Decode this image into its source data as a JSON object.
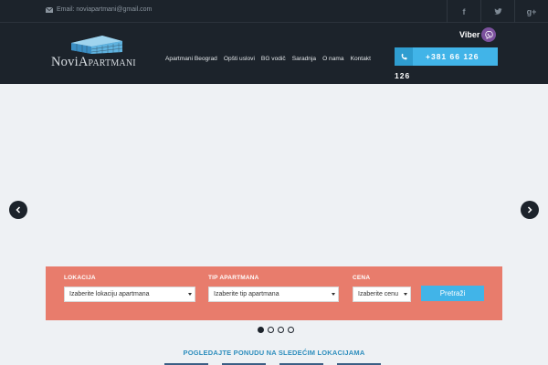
{
  "topbar": {
    "email": "Email: noviapartmani@gmail.com",
    "social": [
      "facebook-icon",
      "twitter-icon",
      "google-plus-icon"
    ]
  },
  "logo": {
    "part1": "Novi",
    "part2": "Apartmani"
  },
  "nav": [
    "Apartmani Beograd",
    "Opšti uslovi",
    "BG vodič",
    "Saradnja",
    "O nama",
    "Kontakt"
  ],
  "viber": {
    "label": "Viber"
  },
  "phone": {
    "line1": "+381 66 126",
    "line2": "126"
  },
  "search": {
    "location_label": "LOKACIJA",
    "location_value": "Izaberite lokaciju apartmana",
    "type_label": "TIP APARTMANA",
    "type_value": "Izaberite tip apartmana",
    "price_label": "CENA",
    "price_value": "Izaberite cenu",
    "submit": "Pretraži"
  },
  "slider": {
    "dots": 4,
    "active": 1
  },
  "caption": "POGLEDAJTE PONUDU NA SLEDEĆIM LOKACIJAMA",
  "colors": {
    "dark": "#1c232b",
    "accent": "#41b4e8",
    "search_bg": "#e87c6c",
    "caption": "#2f8fbe",
    "viber": "#7b519d"
  }
}
